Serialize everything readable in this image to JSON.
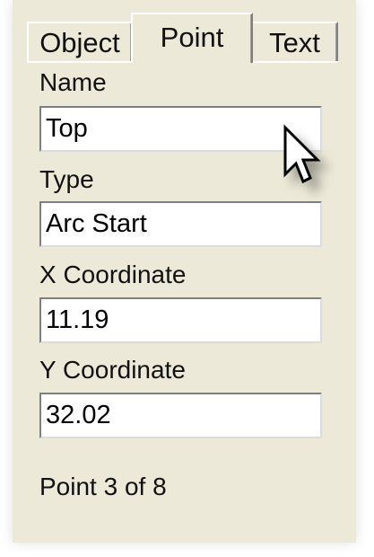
{
  "tabs": [
    {
      "label": "Object",
      "active": false
    },
    {
      "label": "Point",
      "active": true
    },
    {
      "label": "Text",
      "active": false
    }
  ],
  "fields": {
    "name": {
      "label": "Name",
      "value": "Top"
    },
    "type": {
      "label": "Type",
      "value": "Arc Start"
    },
    "x": {
      "label": "X Coordinate",
      "value": "11.19"
    },
    "y": {
      "label": "Y Coordinate",
      "value": "32.02"
    }
  },
  "status": "Point 3 of 8",
  "icons": {
    "cursor": "mouse-pointer-icon"
  },
  "colors": {
    "panel_bg": "#ece9d8",
    "field_bg": "#ffffff"
  }
}
